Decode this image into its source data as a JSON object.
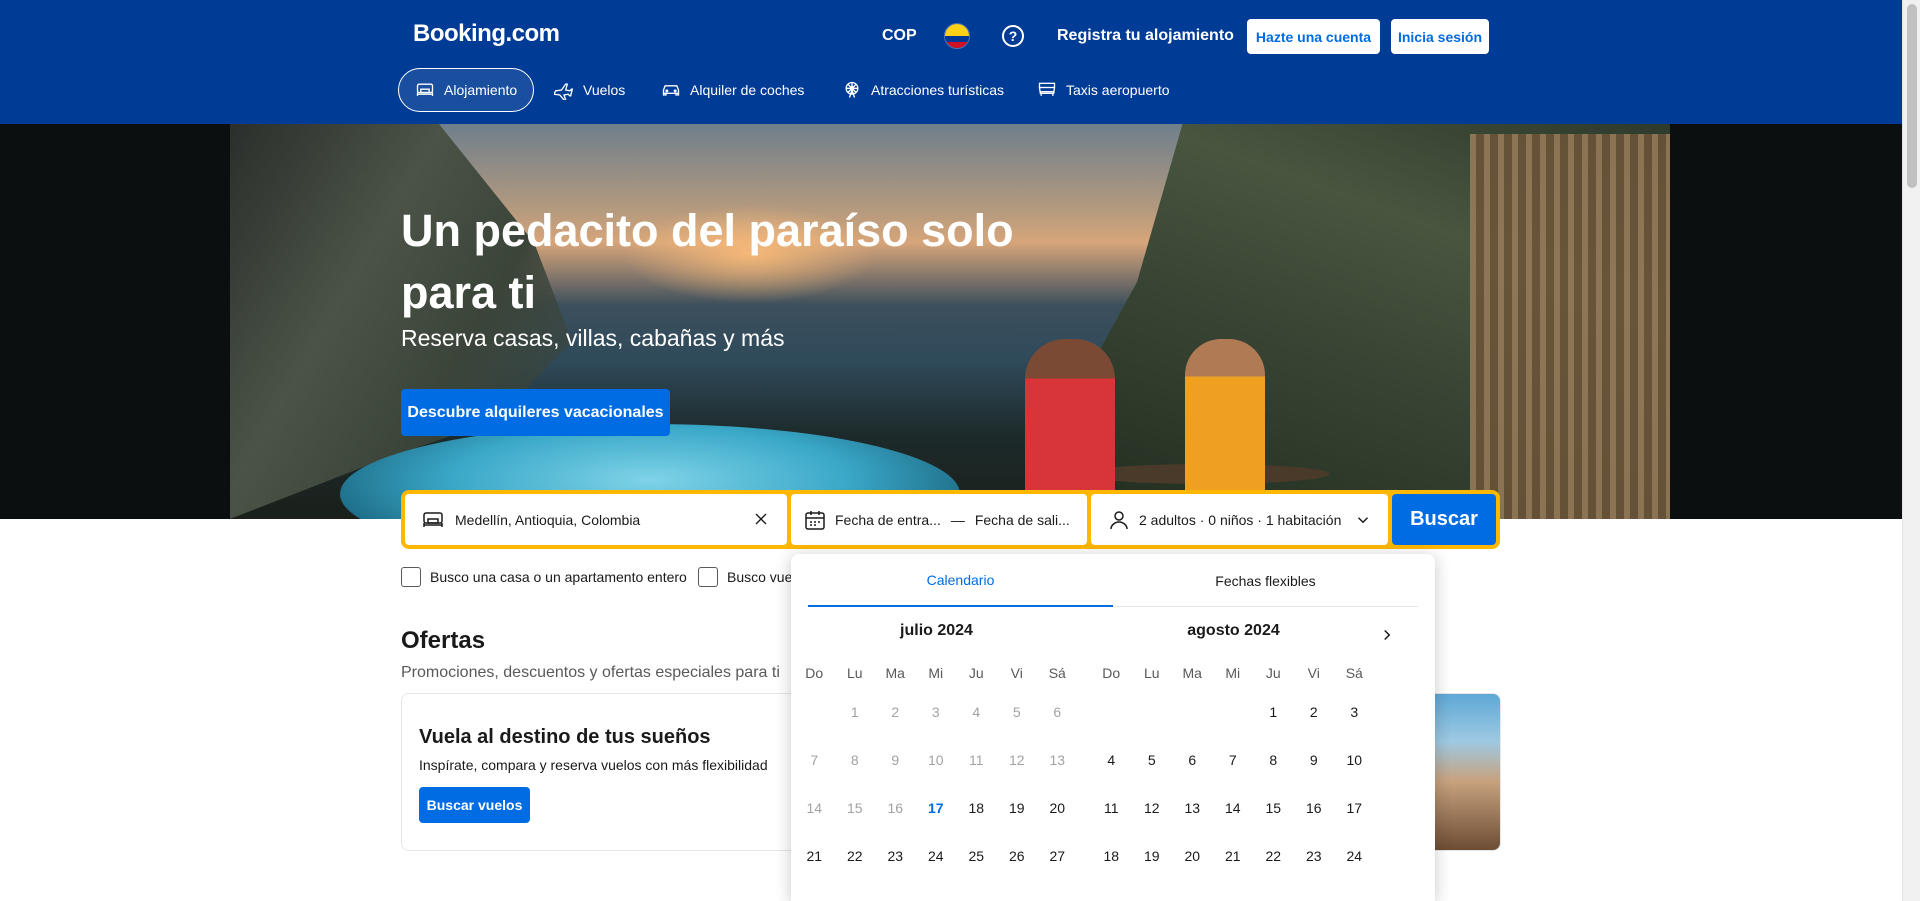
{
  "header": {
    "logo": "Booking.com",
    "currency": "COP",
    "flag_icon": "colombia-flag-icon",
    "help_icon": "question-circle-icon",
    "help_glyph": "?",
    "register_label": "Registra tu alojamiento",
    "signup_label": "Hazte una cuenta",
    "login_label": "Inicia sesión",
    "bg_color": "#003b95"
  },
  "nav": {
    "items": [
      {
        "label": "Alojamiento",
        "icon": "bed-icon",
        "active": true
      },
      {
        "label": "Vuelos",
        "icon": "plane-icon",
        "active": false
      },
      {
        "label": "Alquiler de coches",
        "icon": "car-icon",
        "active": false
      },
      {
        "label": "Atracciones turísticas",
        "icon": "ferris-wheel-icon",
        "active": false
      },
      {
        "label": "Taxis aeropuerto",
        "icon": "taxi-icon",
        "active": false
      }
    ]
  },
  "hero": {
    "title": "Un pedacito del paraíso solo para ti",
    "subtitle": "Reserva casas, villas, cabañas y más",
    "cta_label": "Descubre alquileres vacacionales"
  },
  "search": {
    "destination_value": "Medellín, Antioquia, Colombia",
    "checkin_placeholder": "Fecha de entra...",
    "separator": "—",
    "checkout_placeholder": "Fecha de sali...",
    "guests_value": "2 adultos · 0 niños · 1 habitación",
    "button_label": "Buscar",
    "border_color": "#ffb700",
    "accent_color": "#006ce4"
  },
  "filters": {
    "whole_place_label": "Busco una casa o un apartamento entero",
    "flights_label_partial": "Busco vuel"
  },
  "offers": {
    "title": "Ofertas",
    "subtitle": "Promociones, descuentos y ofertas especiales para ti",
    "card_title": "Vuela al destino de tus sueños",
    "card_desc": "Inspírate, compara y reserva vuelos con más flexibilidad",
    "card_button": "Buscar vuelos"
  },
  "calendar": {
    "tabs": [
      "Calendario",
      "Fechas flexibles"
    ],
    "active_tab": 0,
    "weekdays": [
      "Do",
      "Lu",
      "Ma",
      "Mi",
      "Ju",
      "Vi",
      "Sá"
    ],
    "today": "17",
    "months": [
      {
        "title": "julio 2024",
        "weeks": [
          [
            "",
            "1",
            "2",
            "3",
            "4",
            "5",
            "6"
          ],
          [
            "7",
            "8",
            "9",
            "10",
            "11",
            "12",
            "13"
          ],
          [
            "14",
            "15",
            "16",
            "17",
            "18",
            "19",
            "20"
          ],
          [
            "21",
            "22",
            "23",
            "24",
            "25",
            "26",
            "27"
          ]
        ],
        "past_through": 16
      },
      {
        "title": "agosto 2024",
        "weeks": [
          [
            "",
            "",
            "",
            "",
            "1",
            "2",
            "3"
          ],
          [
            "4",
            "5",
            "6",
            "7",
            "8",
            "9",
            "10"
          ],
          [
            "11",
            "12",
            "13",
            "14",
            "15",
            "16",
            "17"
          ],
          [
            "18",
            "19",
            "20",
            "21",
            "22",
            "23",
            "24"
          ]
        ],
        "past_through": 0
      }
    ],
    "next_icon": "chevron-right-icon"
  }
}
